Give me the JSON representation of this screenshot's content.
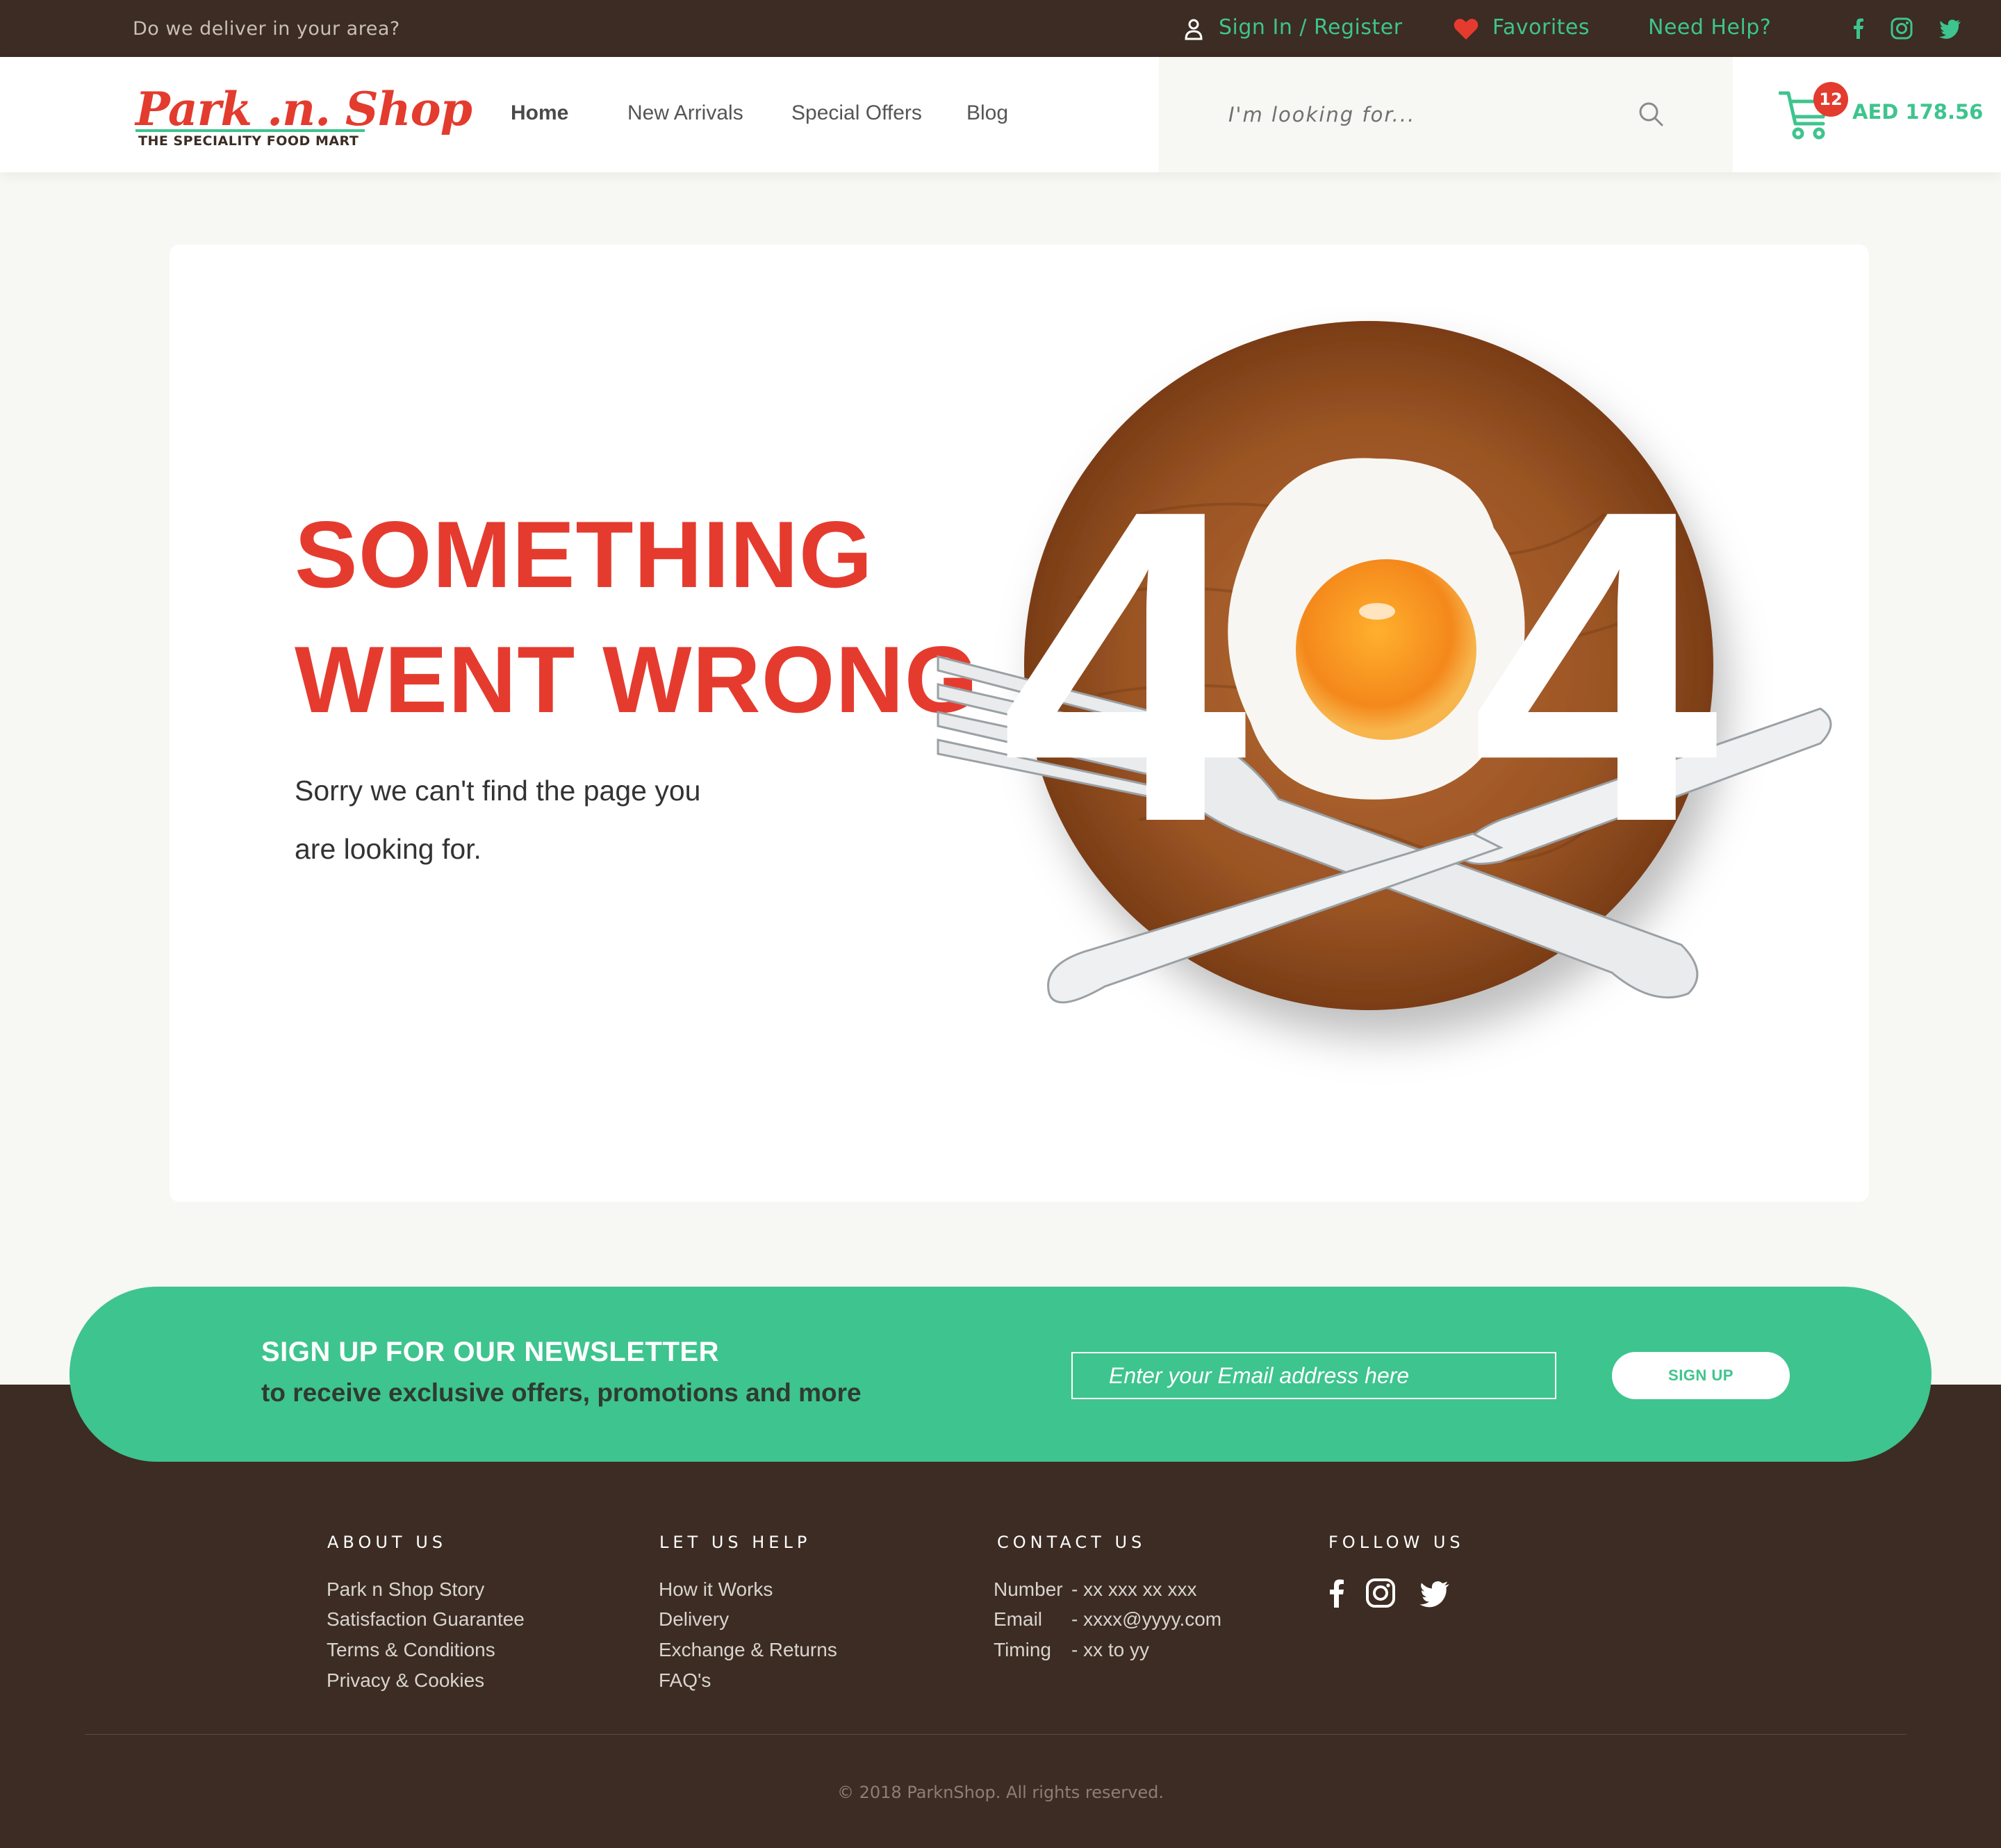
{
  "topbar": {
    "deliver_text": "Do we deliver in your area?",
    "sign_in": "Sign In / Register",
    "favorites": "Favorites",
    "help": "Need Help?",
    "social_icons": [
      "facebook-icon",
      "instagram-icon",
      "twitter-icon"
    ]
  },
  "brand": {
    "logo_script": "Park .n. Shop",
    "logo_tagline": "THE SPECIALITY FOOD MART",
    "accent_green": "#3ec48e",
    "accent_red": "#e53b2f",
    "dark_brown": "#3c2c23"
  },
  "nav": {
    "items": [
      {
        "label": "Home",
        "active": true
      },
      {
        "label": "New Arrivals",
        "active": false
      },
      {
        "label": "Special Offers",
        "active": false
      },
      {
        "label": "Blog",
        "active": false
      }
    ]
  },
  "search": {
    "placeholder": "I'm looking for..."
  },
  "cart": {
    "count": "12",
    "total": "AED 178.56"
  },
  "error": {
    "line1": "SOMETHING",
    "line2": "WENT WRONG",
    "message": "Sorry we can't find the page you are looking for.",
    "code_left": "4",
    "code_right": "4"
  },
  "newsletter": {
    "title": "SIGN UP FOR OUR NEWSLETTER",
    "subtitle": "to receive exclusive offers, promotions and more",
    "placeholder": "Enter your Email address here",
    "button": "SIGN UP"
  },
  "footer": {
    "about": {
      "title": "ABOUT US",
      "links": [
        "Park n Shop Story",
        "Satisfaction Guarantee",
        "Terms & Conditions",
        "Privacy & Cookies"
      ]
    },
    "help": {
      "title": "LET US HELP",
      "links": [
        "How it Works",
        "Delivery",
        "Exchange & Returns",
        "FAQ's"
      ]
    },
    "contact": {
      "title": "CONTACT US",
      "rows": [
        {
          "label": "Number",
          "value": "- xx xxx xx xxx"
        },
        {
          "label": "Email",
          "value": "- xxxx@yyyy.com"
        },
        {
          "label": "Timing",
          "value": "- xx to yy"
        }
      ]
    },
    "follow": {
      "title": "FOLLOW US",
      "icons": [
        "facebook-icon",
        "instagram-icon",
        "twitter-icon"
      ]
    },
    "copyright": "© 2018 ParknShop. All rights reserved."
  }
}
